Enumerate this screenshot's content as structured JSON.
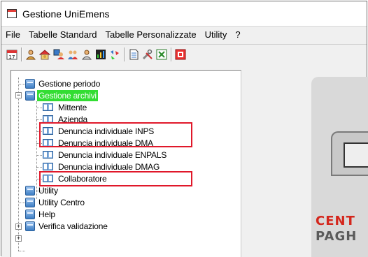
{
  "window": {
    "title": "Gestione UniEmens"
  },
  "menu": {
    "items": [
      "File",
      "Tabelle Standard",
      "Tabelle Personalizzate",
      "Utility",
      "?"
    ]
  },
  "toolbar": {
    "icons": [
      "calendar-icon",
      "user-icon",
      "house-user-icon",
      "grid-user-icon",
      "people-icon",
      "user-alt-icon",
      "chart-icon",
      "pattern-icon",
      "document-icon",
      "tools-icon",
      "excel-icon",
      "stop-icon"
    ]
  },
  "tree": {
    "items": [
      {
        "label": "Gestione periodo",
        "level": 0,
        "type": "folder"
      },
      {
        "label": "Gestione archivi",
        "level": 0,
        "type": "folder",
        "selected": true,
        "expanded": true
      },
      {
        "label": "Mittente",
        "level": 1,
        "type": "book"
      },
      {
        "label": "Azienda",
        "level": 1,
        "type": "book"
      },
      {
        "label": "Denuncia individuale INPS",
        "level": 1,
        "type": "book"
      },
      {
        "label": "Denuncia individuale DMA",
        "level": 1,
        "type": "book"
      },
      {
        "label": "Denuncia individuale ENPALS",
        "level": 1,
        "type": "book"
      },
      {
        "label": "Denuncia individuale DMAG",
        "level": 1,
        "type": "book"
      },
      {
        "label": "Collaboratore",
        "level": 1,
        "type": "book"
      },
      {
        "label": "Utility",
        "level": 0,
        "type": "folder"
      },
      {
        "label": "Utility Centro",
        "level": 0,
        "type": "folder",
        "expandable": true
      },
      {
        "label": "Help",
        "level": 0,
        "type": "folder",
        "expandable": true
      },
      {
        "label": "Verifica validazione",
        "level": 0,
        "type": "folder"
      }
    ]
  },
  "logo": {
    "line1": "CENT",
    "line2": "PAGH"
  },
  "colors": {
    "selection": "#33dd33",
    "highlight": "#e0182a",
    "logo_red": "#d4261c"
  }
}
